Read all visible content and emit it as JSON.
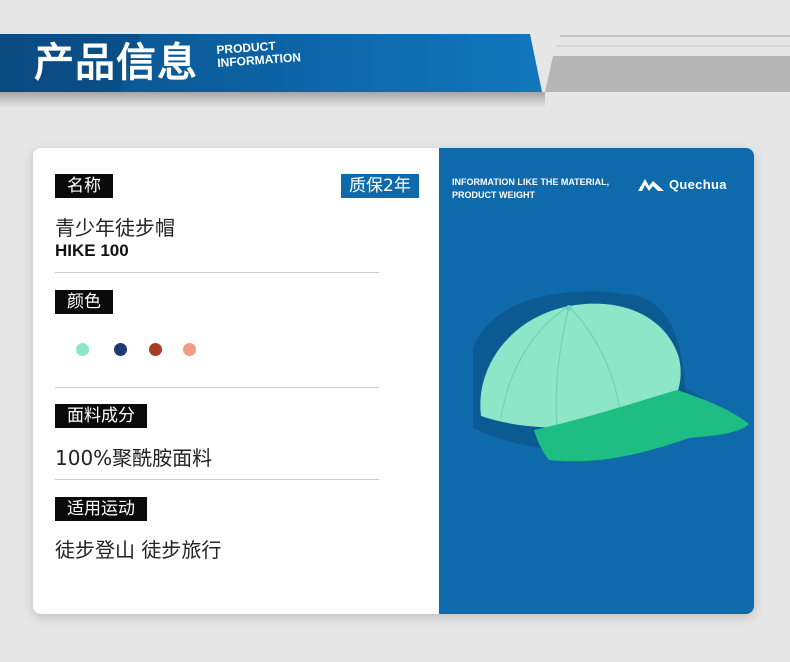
{
  "header": {
    "title": "产品信息",
    "subtitle_line1": "PRODUCT",
    "subtitle_line2": "INFORMATION"
  },
  "product": {
    "name_label": "名称",
    "warranty": "质保2年",
    "name": "青少年徒步帽",
    "model": "HIKE 100",
    "color_label": "颜色",
    "colors": [
      "#8ee6c9",
      "#1e3b73",
      "#a83d24",
      "#f39c84"
    ],
    "material_label": "面料成分",
    "material": "100%聚酰胺面料",
    "usage_label": "适用运动",
    "usage": "徒步登山 徒步旅行"
  },
  "panel": {
    "info_line1": "INFORMATION LIKE THE MATERIAL,",
    "info_line2": "PRODUCT WEIGHT",
    "brand": "Quechua",
    "background": "#0f6aac",
    "cap_crown": "#8ee6c9",
    "cap_brim": "#1dbd84"
  }
}
